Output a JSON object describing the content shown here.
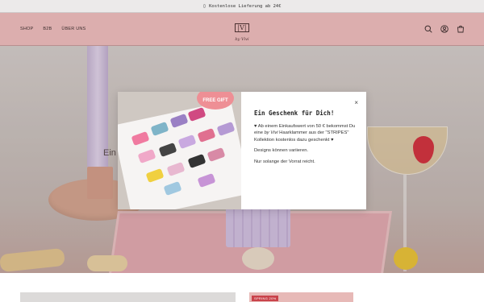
{
  "announcement": {
    "icon": "truck-icon",
    "text": "Kostenlose Lieferung ab 24€"
  },
  "nav": {
    "items": [
      "SHOP",
      "B2B",
      "ÜBER UNS"
    ]
  },
  "logo": {
    "mark": "|V|",
    "script": "by Vivi"
  },
  "header_icons": [
    "search-icon",
    "account-icon",
    "cart-icon"
  ],
  "hero": {
    "partial_text": "Ein"
  },
  "popup": {
    "image_tag": "FREE GIFT",
    "title": "Ein Geschenk für Dich!",
    "para1_pre": "♥ Ab einem Einkaufswert von 50 € bekommst Du eine ",
    "para1_em": "by Vivi",
    "para1_post": " Haarklammer aus der \"STRIPES\" Kollektion kostenlos dazu geschenkt ♥",
    "para2": "Designs können variieren.",
    "para3": "Nur solange der Vorrat reicht.",
    "close_label": "×"
  },
  "product_badge": "SPRING 20%",
  "colors": {
    "header_bg": "#dcaeae",
    "accent": "#c9424a"
  }
}
